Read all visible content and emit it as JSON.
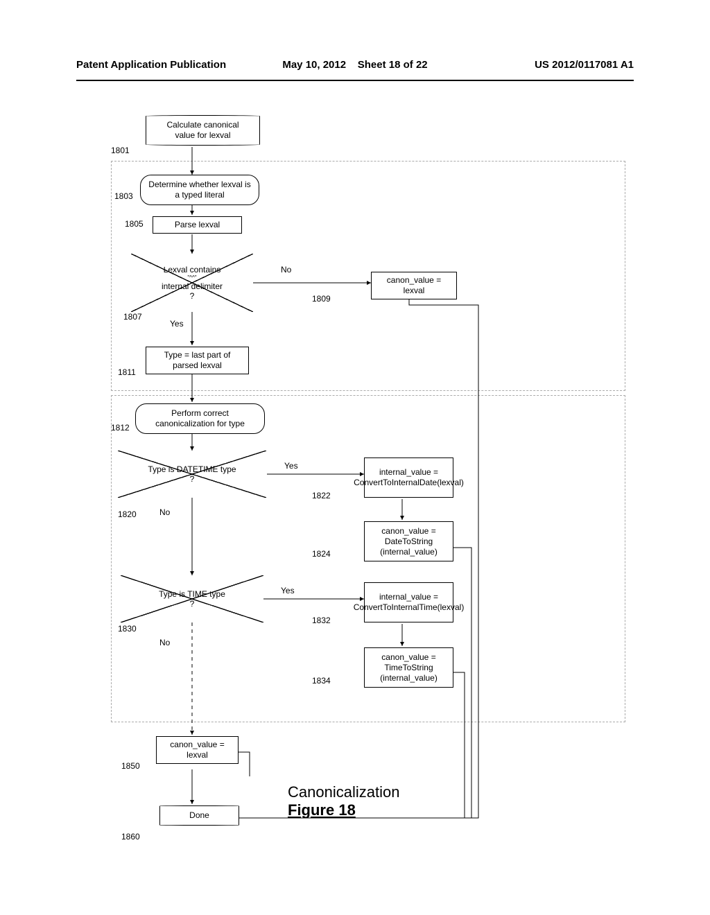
{
  "header": {
    "left": "Patent Application Publication",
    "date": "May 10, 2012",
    "sheet": "Sheet 18 of 22",
    "docnum": "US 2012/0117081 A1"
  },
  "nodes": {
    "n1801": "Calculate canonical value for lexval",
    "n1803": "Determine whether lexval is a typed literal",
    "n1805": "Parse lexval",
    "n1807_l1": "Lexval contains",
    "n1807_l2": "\"^^\"",
    "n1807_l3": "internal delimiter",
    "n1807_l4": "?",
    "n1809": "canon_value = lexval",
    "n1811": "Type = last part of parsed lexval",
    "n1812": "Perform correct canonicalization for type",
    "n1820_l1": "Type is DATETIME type",
    "n1820_l2": "?",
    "n1822": "internal_value = ConvertToInternalDate(lexval)",
    "n1824": "canon_value = DateToString (internal_value)",
    "n1830_l1": "Type is TIME  type",
    "n1830_l2": "?",
    "n1832": "internal_value = ConvertToInternalTime(lexval)",
    "n1834": "canon_value = TimeToString (internal_value)",
    "n1850": "canon_value = lexval",
    "n1860": "Done"
  },
  "labels": {
    "yes": "Yes",
    "no": "No"
  },
  "refs": {
    "r1801": "1801",
    "r1803": "1803",
    "r1805": "1805",
    "r1807": "1807",
    "r1809": "1809",
    "r1811": "1811",
    "r1812": "1812",
    "r1820": "1820",
    "r1822": "1822",
    "r1824": "1824",
    "r1830": "1830",
    "r1832": "1832",
    "r1834": "1834",
    "r1850": "1850",
    "r1860": "1860"
  },
  "figure": {
    "title": "Canonicalization",
    "num": "Figure 18"
  }
}
